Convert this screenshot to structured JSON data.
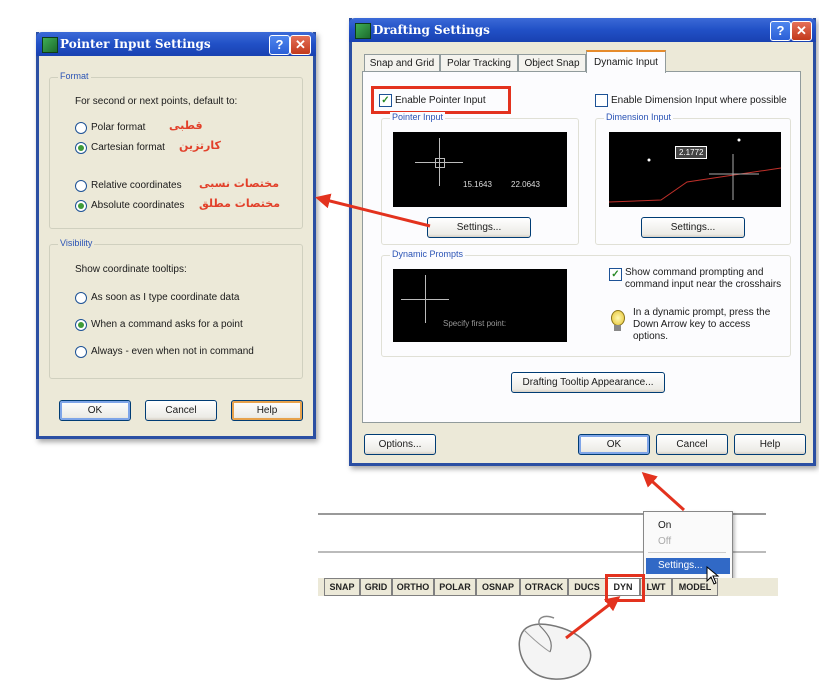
{
  "pointer_dialog": {
    "title": "Pointer Input Settings",
    "help_icon": "question-mark-icon",
    "close_icon": "close-x-icon",
    "format_group": "Format",
    "format_prompt": "For second or next points, default to:",
    "polar_label": "Polar format",
    "polar_fa": "قطبی",
    "cartesian_label": "Cartesian format",
    "cartesian_fa": "کارتزین",
    "relative_label": "Relative coordinates",
    "relative_fa": "مختصات نسبی",
    "absolute_label": "Absolute coordinates",
    "absolute_fa": "مختصات مطلق",
    "visibility_group": "Visibility",
    "visibility_prompt": "Show coordinate tooltips:",
    "opt_type": "As soon as I type coordinate data",
    "opt_command": "When a command asks for a point",
    "opt_always": "Always - even when not in command",
    "ok": "OK",
    "cancel": "Cancel",
    "help": "Help"
  },
  "drafting_dialog": {
    "title": "Drafting Settings",
    "tabs": [
      "Snap and Grid",
      "Polar Tracking",
      "Object Snap",
      "Dynamic Input"
    ],
    "enable_pointer": "Enable Pointer Input",
    "enable_dimension": "Enable Dimension Input where possible",
    "pointer_group": "Pointer Input",
    "dimension_group": "Dimension Input",
    "coord_x": "15.1643",
    "coord_y": "22.0643",
    "dim_value": "2.1772",
    "settings_btn": "Settings...",
    "prompts_group": "Dynamic Prompts",
    "specify_text": "Specify first point:",
    "show_command": "Show command prompting and command input near the crosshairs",
    "hint": "In a dynamic prompt, press the Down Arrow key to access options.",
    "tooltip_btn": "Drafting Tooltip Appearance...",
    "options_btn": "Options...",
    "ok": "OK",
    "cancel": "Cancel",
    "help": "Help"
  },
  "context_menu": {
    "on": "On",
    "off": "Off",
    "settings": "Settings..."
  },
  "status_bar": {
    "buttons": [
      "SNAP",
      "GRID",
      "ORTHO",
      "POLAR",
      "OSNAP",
      "OTRACK",
      "DUCS",
      "DYN",
      "LWT",
      "MODEL"
    ]
  },
  "colors": {
    "highlight_red": "#e3321e",
    "title_blue": "#2150c6",
    "dialog_bg": "#ece9d8",
    "farsi_label": "#e2402a"
  }
}
